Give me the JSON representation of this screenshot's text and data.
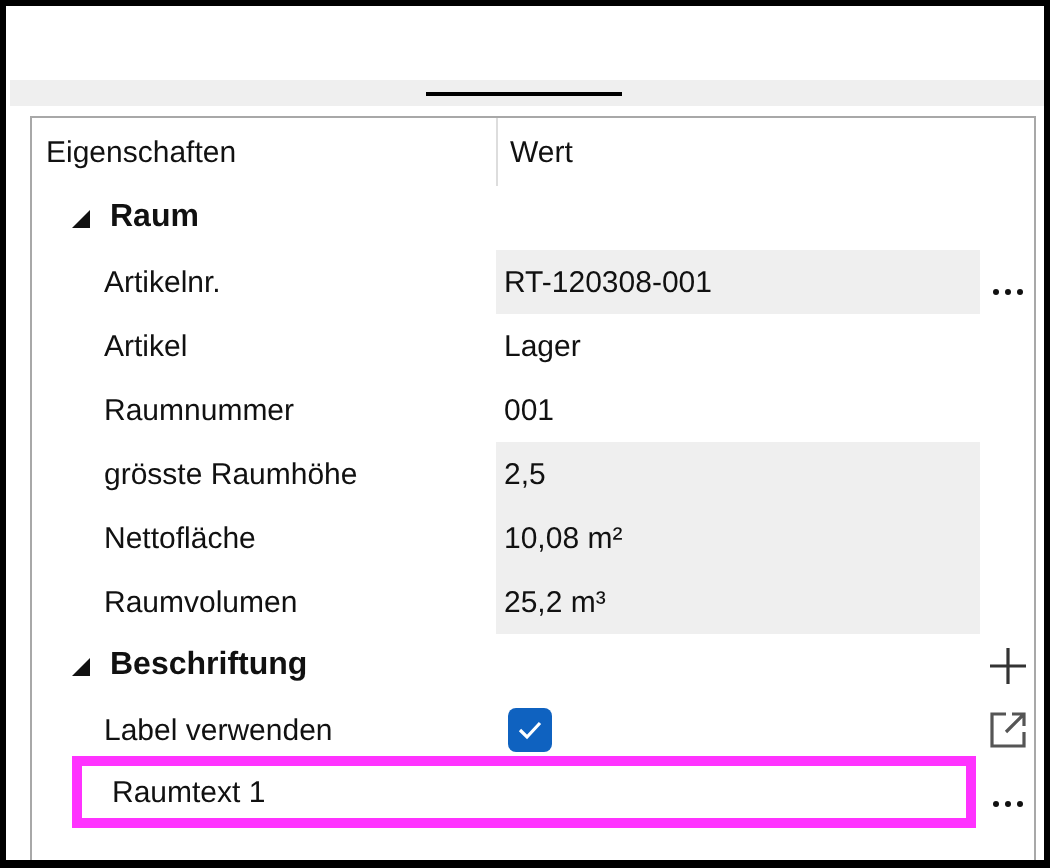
{
  "columns": [
    "Eigenschaften",
    "Wert"
  ],
  "groups": [
    {
      "title": "Raum",
      "expanded": true,
      "add_button": false,
      "rows": [
        {
          "kind": "text",
          "label": "Artikelnr.",
          "value": "RT-120308-001",
          "readonly": true,
          "more_button": true,
          "open_button": false
        },
        {
          "kind": "text",
          "label": "Artikel",
          "value": "Lager",
          "readonly": false,
          "more_button": false,
          "open_button": false
        },
        {
          "kind": "text",
          "label": "Raumnummer",
          "value": "001",
          "readonly": false,
          "more_button": false,
          "open_button": false
        },
        {
          "kind": "text",
          "label": "grösste Raumhöhe",
          "value": "2,5",
          "readonly": true,
          "more_button": false,
          "open_button": false
        },
        {
          "kind": "text",
          "label": "Nettofläche",
          "value": "10,08 m²",
          "readonly": true,
          "more_button": false,
          "open_button": false
        },
        {
          "kind": "text",
          "label": "Raumvolumen",
          "value": "25,2 m³",
          "readonly": true,
          "more_button": false,
          "open_button": false
        }
      ]
    },
    {
      "title": "Beschriftung",
      "expanded": true,
      "add_button": true,
      "rows": [
        {
          "kind": "checkbox",
          "label": "Label verwenden",
          "checked": true,
          "more_button": false,
          "open_button": true
        },
        {
          "kind": "wide",
          "label": "Raumtext 1",
          "highlighted": true,
          "more_button": true,
          "open_button": false
        }
      ]
    }
  ]
}
